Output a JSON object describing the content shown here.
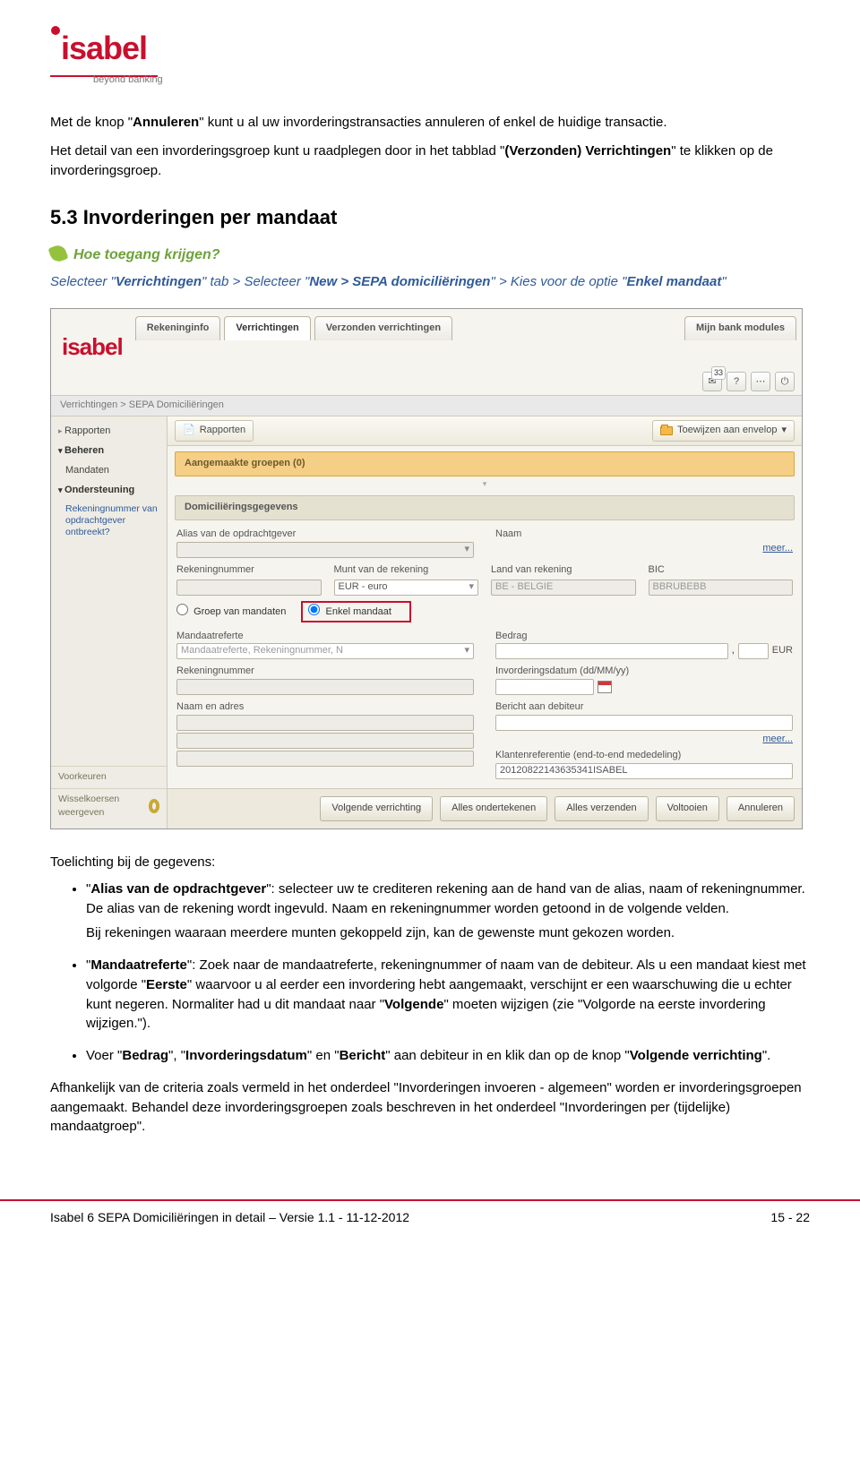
{
  "brand": {
    "name": "isabel",
    "tag": "beyond banking"
  },
  "para1a": "Met de knop \"",
  "para1b": "Annuleren",
  "para1c": "\" kunt u al uw invorderingstransacties annuleren of enkel de huidige transactie.",
  "para2a": "Het detail van een invorderingsgroep kunt u raadplegen door in het tabblad \"",
  "para2b": "(Verzonden) Verrichtingen",
  "para2c": "\" te klikken op de invorderingsgroep.",
  "section_title": "5.3 Invorderingen per mandaat",
  "access_q": "Hoe toegang krijgen?",
  "nav_instr_plain1": "Selecteer \"",
  "nav_instr_b1": "Verrichtingen",
  "nav_instr_plain2": "\" tab > Selecteer \"",
  "nav_instr_b2": "New > SEPA domiciliëringen",
  "nav_instr_plain3": "\" > Kies voor de optie \"",
  "nav_instr_b3": "Enkel mandaat",
  "nav_instr_plain4": "\"",
  "app": {
    "tabs": {
      "t1": "Rekeninginfo",
      "t2": "Verrichtingen",
      "t3": "Verzonden verrichtingen",
      "t4": "Mijn bank modules"
    },
    "breadcrumb": "Verrichtingen > SEPA Domiciliëringen",
    "toolbar": {
      "assign": "Toewijzen aan envelop",
      "reports": "Rapporten"
    },
    "sidebar": {
      "s_reports": "Rapporten",
      "s_beheren": "Beheren",
      "s_mandaten": "Mandaten",
      "s_onderst": "Ondersteuning",
      "s_sub": "Rekeningnummer van opdrachtgever ontbreekt?",
      "s_voorkeuren": "Voorkeuren",
      "s_wissel": "Wisselkoersen weergeven"
    },
    "band_groups": "Aangemaakte groepen (0)",
    "band_details": "Domiciliëringsgegevens",
    "labels": {
      "alias": "Alias van de opdrachtgever",
      "naam": "Naam",
      "rek": "Rekeningnummer",
      "munt": "Munt van de rekening",
      "land": "Land van rekening",
      "bic": "BIC",
      "groep": "Groep van mandaten",
      "enkel": "Enkel mandaat",
      "mref": "Mandaatreferte",
      "mref_ph": "Mandaatreferte, Rekeningnummer, N",
      "bedrag": "Bedrag",
      "invdat": "Invorderingsdatum (dd/MM/yy)",
      "naamadr": "Naam en adres",
      "bericht": "Bericht aan debiteur",
      "klantref": "Klantenreferentie (end-to-end mededeling)",
      "klantref_val": "20120822143635341ISABEL",
      "eur": "EUR",
      "eur_euro": "EUR - euro",
      "land_val": "BE - BELGIE",
      "bic_val": "BBRUBEBB",
      "meer": "meer..."
    },
    "buttons": {
      "b1": "Volgende verrichting",
      "b2": "Alles ondertekenen",
      "b3": "Alles verzenden",
      "b4": "Voltooien",
      "b5": "Annuleren"
    },
    "badge": "33"
  },
  "expl_head": "Toelichting bij de gegevens:",
  "bullets": {
    "b1_bold": "Alias van de opdrachtgever",
    "b1_t1": "\": selecteer uw te crediteren rekening aan de hand van de alias, naam of rekeningnummer. De alias van de rekening wordt ingevuld. Naam en rekeningnummer worden getoond in de volgende velden.",
    "b1_t2": "Bij rekeningen waaraan meerdere munten gekoppeld zijn, kan de gewenste munt gekozen worden.",
    "b2_bold": "Mandaatreferte",
    "b2_t1": "\": Zoek naar de mandaatreferte, rekeningnummer of naam van de debiteur. Als u een mandaat kiest met volgorde \"",
    "b2_bold2": "Eerste",
    "b2_t2": "\" waarvoor u al eerder een invordering hebt aangemaakt, verschijnt er een waarschuwing die u echter kunt negeren. Normaliter had u dit mandaat naar \"",
    "b2_bold3": "Volgende",
    "b2_t3": "\" moeten wijzigen (zie \"Volgorde na eerste invordering wijzigen.\").",
    "b3_pre": "Voer \"",
    "b3_bold1": "Bedrag",
    "b3_mid1": "\", \"",
    "b3_bold2": "Invorderingsdatum",
    "b3_mid2": "\" en \"",
    "b3_bold3": "Bericht",
    "b3_mid3": "\" aan debiteur in en klik dan op de knop \"",
    "b3_bold4": "Volgende verrichting",
    "b3_end": "\"."
  },
  "closing": "Afhankelijk van de criteria zoals vermeld in het onderdeel \"Invorderingen invoeren - algemeen\" worden er invorderingsgroepen aangemaakt. Behandel deze invorderingsgroepen zoals beschreven in het onderdeel \"Invorderingen per (tijdelijke) mandaatgroep\".",
  "footer": {
    "left": "Isabel 6 SEPA Domiciliëringen in detail – Versie 1.1 - 11-12-2012",
    "right": "15 - 22"
  }
}
